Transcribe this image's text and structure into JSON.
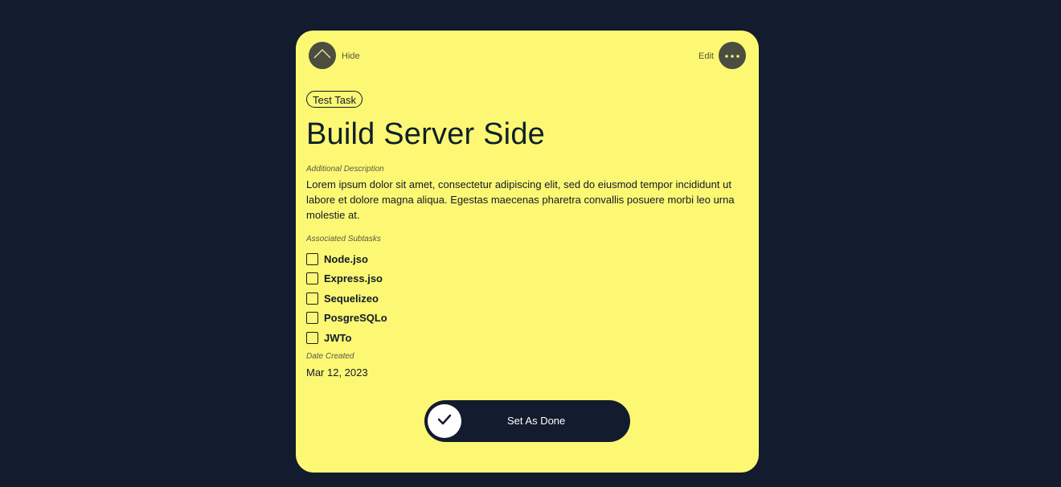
{
  "header": {
    "hide_label": "Hide",
    "edit_label": "Edit",
    "hide_icon": "chevron-up-icon",
    "more_icon": "more-horizontal-icon"
  },
  "task": {
    "tag": "Test Task",
    "title": "Build Server Side",
    "description_label": "Additional Description",
    "description": "Lorem ipsum dolor sit amet, consectetur adipiscing elit, sed do eiusmod tempor incididunt ut labore et dolore magna aliqua. Egestas maecenas pharetra convallis posuere morbi leo urna molestie at.",
    "subtasks_label": "Associated Subtasks",
    "subtasks": [
      {
        "label": "Node.jso",
        "checked": false
      },
      {
        "label": "Express.jso",
        "checked": false
      },
      {
        "label": "Sequelizeo",
        "checked": false
      },
      {
        "label": "PosgreSQLo",
        "checked": false
      },
      {
        "label": "JWTo",
        "checked": false
      }
    ],
    "date_label": "Date Created",
    "date": "Mar 12, 2023"
  },
  "action": {
    "done_label": "Set As Done",
    "done_icon": "check-icon"
  },
  "colors": {
    "page_background": "#131b2e",
    "card_background": "#fdf873",
    "button_dark": "#4a4d3f",
    "text_dark": "#0f1a2a"
  }
}
